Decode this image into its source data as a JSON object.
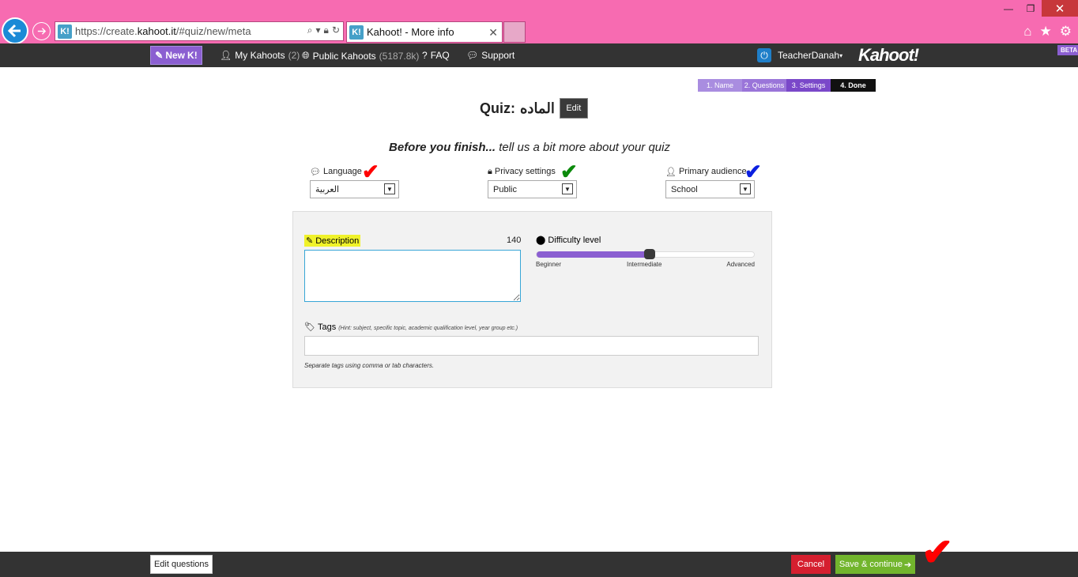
{
  "browser": {
    "url_prefix": "https://create.",
    "url_host": "kahoot.it",
    "url_path": "/#quiz/new/meta",
    "tab_title": "Kahoot! - More info",
    "favicon_label": "K!"
  },
  "navbar": {
    "new_label": "New",
    "new_logo": "K!",
    "my_kahoots_label": "My Kahoots",
    "my_kahoots_count": "(2)",
    "public_kahoots_label": "Public Kahoots",
    "public_kahoots_count": "(5187.8k)",
    "faq_label": "FAQ",
    "support_label": "Support",
    "username": "TeacherDanah",
    "logo": "Kahoot!",
    "beta_badge": "BETA"
  },
  "steps": [
    "1. Name",
    "2. Questions",
    "3. Settings",
    "4. Done"
  ],
  "quiz": {
    "title_prefix": "Quiz:",
    "title_name": "الماده",
    "edit_label": "Edit"
  },
  "intro": {
    "bold": "Before you finish...",
    "rest": " tell us a bit more about your quiz"
  },
  "fields": {
    "language": {
      "label": "Language",
      "value": "العربية"
    },
    "privacy": {
      "label": "Privacy settings",
      "value": "Public"
    },
    "audience": {
      "label": "Primary audience",
      "value": "School"
    }
  },
  "description": {
    "label": "Description",
    "remaining": "140",
    "value": ""
  },
  "difficulty": {
    "label": "Difficulty level",
    "level_fraction": 0.5,
    "beginner": "Beginner",
    "intermediate": "Intermediate",
    "advanced": "Advanced"
  },
  "tags": {
    "label": "Tags",
    "hint": "(Hint: subject, specific topic, academic qualification level, year group etc.)",
    "value": "",
    "help": "Separate tags using comma or tab characters."
  },
  "footer": {
    "edit_questions": "Edit questions",
    "cancel": "Cancel",
    "save_continue": "Save & continue"
  },
  "colors": {
    "chrome": "#f76bb1",
    "kahoot_purple": "#8b5fd1",
    "cancel_red": "#d51f2f",
    "save_green": "#72b52d",
    "check_red": "#ff0000",
    "check_green": "#0b8a0b",
    "check_blue": "#0b1fe0"
  }
}
